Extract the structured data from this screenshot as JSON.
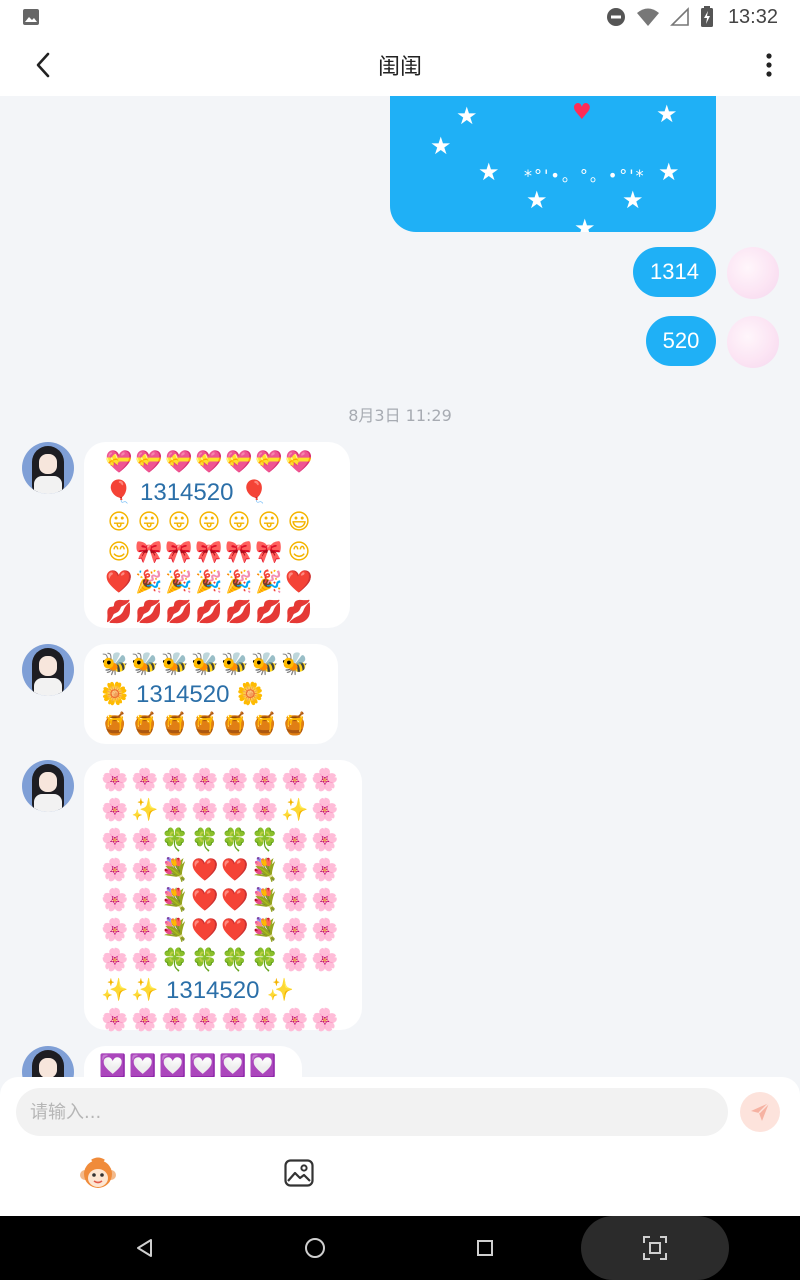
{
  "status_bar": {
    "time": "13:32",
    "icons": [
      "image-icon",
      "do-not-disturb-icon",
      "wifi-icon",
      "signal-icon",
      "battery-charging-icon"
    ]
  },
  "header": {
    "title": "闺闺",
    "back_icon": "chevron-left-icon",
    "menu_icon": "more-vertical-icon"
  },
  "messages": {
    "sent_1314": "1314",
    "sent_520": "520",
    "timestamp": "8月3日 11:29",
    "card_text": "*°'•。°。•°'*",
    "number": "1314520"
  },
  "emoji_grids": {
    "grid1": [
      [
        [
          "💝",
          "c-gift"
        ],
        [
          "💝",
          "c-gift"
        ],
        [
          "💝",
          "c-gift"
        ],
        [
          "💝",
          "c-gift"
        ],
        [
          "💝",
          "c-gift"
        ],
        [
          "💝",
          "c-gift"
        ],
        [
          "💝",
          "c-gift"
        ]
      ],
      [
        [
          "🎈",
          "c-balloon"
        ],
        [
          "#num",
          ""
        ],
        [
          "🎈",
          "c-balloon"
        ]
      ],
      [
        [
          "😛",
          "c-smile"
        ],
        [
          "😛",
          "c-smile"
        ],
        [
          "😛",
          "c-smile"
        ],
        [
          "😛",
          "c-smile"
        ],
        [
          "😛",
          "c-smile"
        ],
        [
          "😛",
          "c-smile"
        ],
        [
          "😃",
          "c-smile"
        ]
      ],
      [
        [
          "😊",
          "c-smile"
        ],
        [
          "🎀",
          "c-bow"
        ],
        [
          "🎀",
          "c-bow"
        ],
        [
          "🎀",
          "c-bow"
        ],
        [
          "🎀",
          "c-bow"
        ],
        [
          "🎀",
          "c-bow"
        ],
        [
          "😊",
          "c-smile"
        ]
      ],
      [
        [
          "❤️",
          "c-heart"
        ],
        [
          "🎉",
          "c-party"
        ],
        [
          "🎉",
          "c-party"
        ],
        [
          "🎉",
          "c-party"
        ],
        [
          "🎉",
          "c-party"
        ],
        [
          "🎉",
          "c-party"
        ],
        [
          "❤️",
          "c-heart"
        ]
      ],
      [
        [
          "💋",
          "c-kiss"
        ],
        [
          "💋",
          "c-kiss"
        ],
        [
          "💋",
          "c-kiss"
        ],
        [
          "💋",
          "c-kiss"
        ],
        [
          "💋",
          "c-kiss"
        ],
        [
          "💋",
          "c-kiss"
        ],
        [
          "💋",
          "c-kiss"
        ]
      ]
    ],
    "grid2": [
      [
        [
          "🐝",
          "c-bee"
        ],
        [
          "🐝",
          "c-bee"
        ],
        [
          "🐝",
          "c-bee"
        ],
        [
          "🐝",
          "c-bee"
        ],
        [
          "🐝",
          "c-bee"
        ],
        [
          "🐝",
          "c-bee"
        ],
        [
          "🐝",
          "c-bee"
        ]
      ],
      [
        [
          "🌼",
          "c-daisy"
        ],
        [
          "#num",
          ""
        ],
        [
          "🌼",
          "c-daisy"
        ]
      ],
      [
        [
          "🍯",
          "c-honey"
        ],
        [
          "🍯",
          "c-honey"
        ],
        [
          "🍯",
          "c-honey"
        ],
        [
          "🍯",
          "c-honey"
        ],
        [
          "🍯",
          "c-honey"
        ],
        [
          "🍯",
          "c-honey"
        ],
        [
          "🍯",
          "c-honey"
        ]
      ]
    ],
    "grid3": [
      [
        [
          "🌸",
          "c-sakura"
        ],
        [
          "🌸",
          "c-sakura"
        ],
        [
          "🌸",
          "c-sakura"
        ],
        [
          "🌸",
          "c-sakura"
        ],
        [
          "🌸",
          "c-sakura"
        ],
        [
          "🌸",
          "c-sakura"
        ],
        [
          "🌸",
          "c-sakura"
        ],
        [
          "🌸",
          "c-sakura"
        ]
      ],
      [
        [
          "🌸",
          "c-sakura"
        ],
        [
          "✨",
          "c-spark"
        ],
        [
          "🌸",
          "c-sakura"
        ],
        [
          "🌸",
          "c-sakura"
        ],
        [
          "🌸",
          "c-sakura"
        ],
        [
          "🌸",
          "c-sakura"
        ],
        [
          "✨",
          "c-spark"
        ],
        [
          "🌸",
          "c-sakura"
        ]
      ],
      [
        [
          "🌸",
          "c-sakura"
        ],
        [
          "🌸",
          "c-sakura"
        ],
        [
          "🍀",
          "c-clover"
        ],
        [
          "🍀",
          "c-clover"
        ],
        [
          "🍀",
          "c-clover"
        ],
        [
          "🍀",
          "c-clover"
        ],
        [
          "🌸",
          "c-sakura"
        ],
        [
          "🌸",
          "c-sakura"
        ]
      ],
      [
        [
          "🌸",
          "c-sakura"
        ],
        [
          "🌸",
          "c-sakura"
        ],
        [
          "💐",
          "c-flower"
        ],
        [
          "❤️",
          "c-heart"
        ],
        [
          "❤️",
          "c-heart"
        ],
        [
          "💐",
          "c-flower"
        ],
        [
          "🌸",
          "c-sakura"
        ],
        [
          "🌸",
          "c-sakura"
        ]
      ],
      [
        [
          "🌸",
          "c-sakura"
        ],
        [
          "🌸",
          "c-sakura"
        ],
        [
          "💐",
          "c-flower"
        ],
        [
          "❤️",
          "c-heart"
        ],
        [
          "❤️",
          "c-heart"
        ],
        [
          "💐",
          "c-flower"
        ],
        [
          "🌸",
          "c-sakura"
        ],
        [
          "🌸",
          "c-sakura"
        ]
      ],
      [
        [
          "🌸",
          "c-sakura"
        ],
        [
          "🌸",
          "c-sakura"
        ],
        [
          "💐",
          "c-flower"
        ],
        [
          "❤️",
          "c-heart"
        ],
        [
          "❤️",
          "c-heart"
        ],
        [
          "💐",
          "c-flower"
        ],
        [
          "🌸",
          "c-sakura"
        ],
        [
          "🌸",
          "c-sakura"
        ]
      ],
      [
        [
          "🌸",
          "c-sakura"
        ],
        [
          "🌸",
          "c-sakura"
        ],
        [
          "🍀",
          "c-clover"
        ],
        [
          "🍀",
          "c-clover"
        ],
        [
          "🍀",
          "c-clover"
        ],
        [
          "🍀",
          "c-clover"
        ],
        [
          "🌸",
          "c-sakura"
        ],
        [
          "🌸",
          "c-sakura"
        ]
      ],
      [
        [
          "✨",
          "c-spark"
        ],
        [
          "✨",
          "c-spark"
        ],
        [
          "#num",
          ""
        ],
        [
          "✨",
          "c-spark"
        ]
      ],
      [
        [
          "🌸",
          "c-sakura"
        ],
        [
          "🌸",
          "c-sakura"
        ],
        [
          "🌸",
          "c-sakura"
        ],
        [
          "🌸",
          "c-sakura"
        ],
        [
          "🌸",
          "c-sakura"
        ],
        [
          "🌸",
          "c-sakura"
        ],
        [
          "🌸",
          "c-sakura"
        ],
        [
          "🌸",
          "c-sakura"
        ]
      ]
    ],
    "grid4": [
      [
        [
          "💟",
          "c-heartw"
        ],
        [
          "💟",
          "c-heartw"
        ],
        [
          "💟",
          "c-heartw"
        ],
        [
          "💟",
          "c-heartw"
        ],
        [
          "💟",
          "c-heartw"
        ],
        [
          "💟",
          "c-heartw"
        ]
      ]
    ]
  },
  "input": {
    "placeholder": "请输入...",
    "value": "",
    "send_icon": "send-icon",
    "tools": [
      "monkey-emoji-icon",
      "image-icon"
    ]
  },
  "nav_bar": {
    "icons": [
      "back-triangle-icon",
      "home-circle-icon",
      "recents-square-icon",
      "screenshot-icon"
    ]
  },
  "colors": {
    "bubble_blue": "#1fb0f6",
    "background": "#f3f5f8",
    "number_blue": "#2b6fa8"
  }
}
